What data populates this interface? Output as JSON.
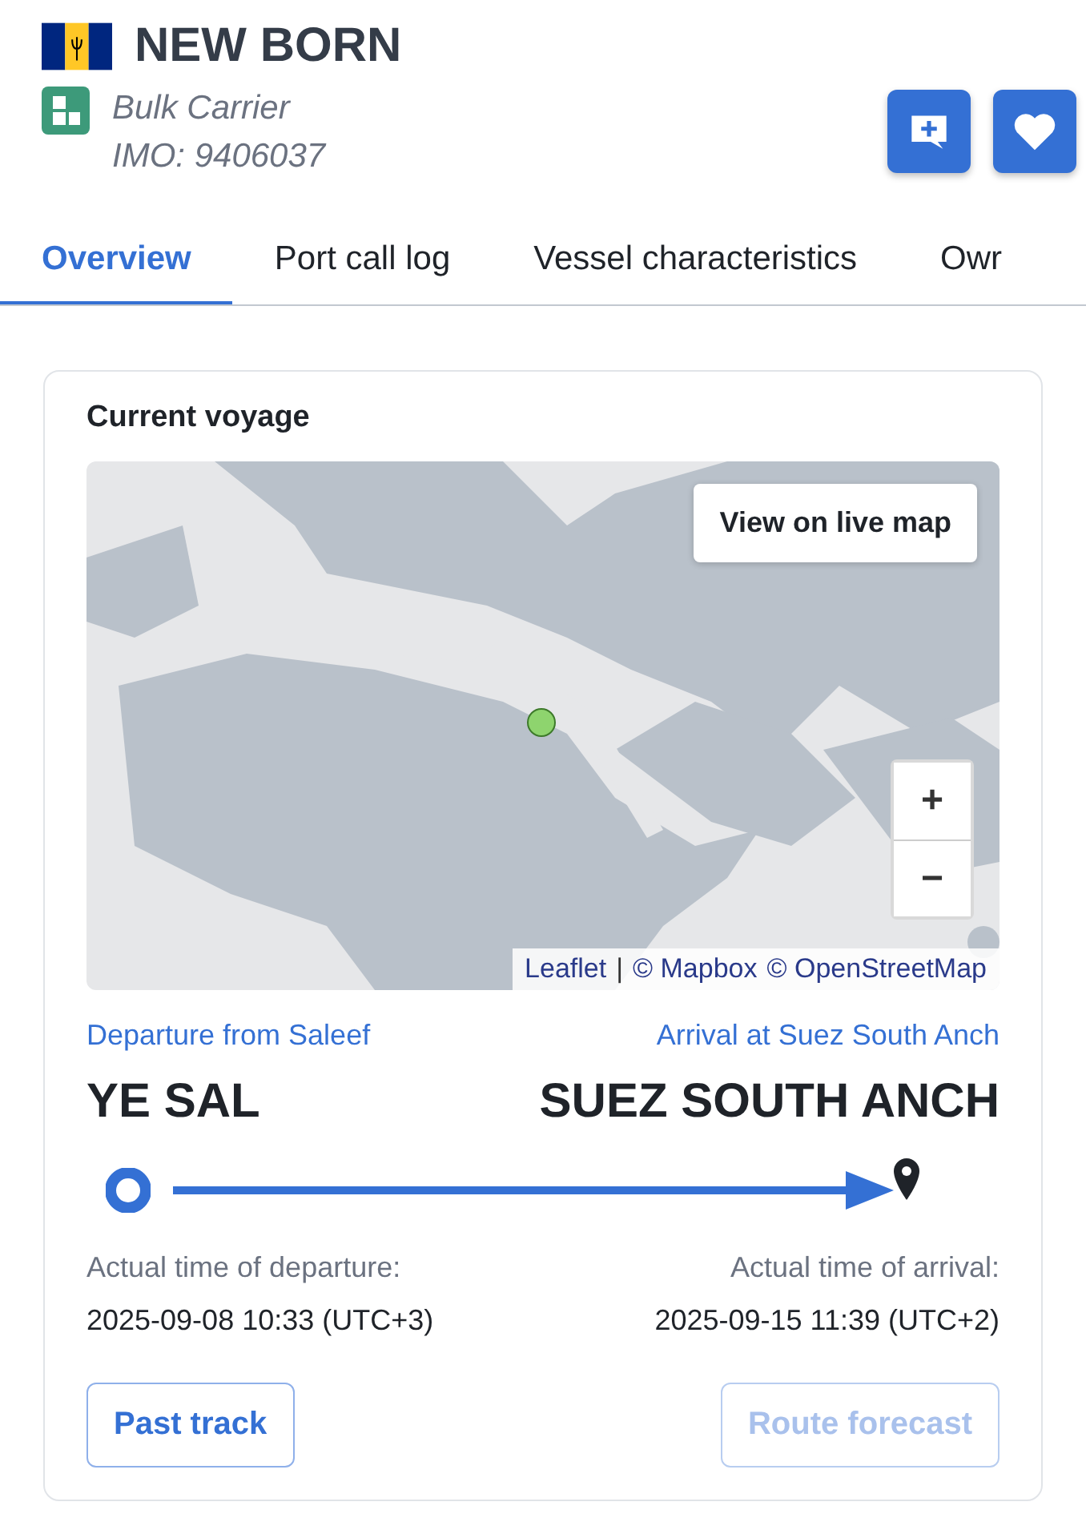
{
  "vessel": {
    "name": "NEW BORN",
    "type": "Bulk Carrier",
    "imo": "IMO: 9406037"
  },
  "actions": [
    {
      "kind": "note"
    },
    {
      "kind": "favorite"
    }
  ],
  "tabs": [
    {
      "label": "Overview",
      "selected": true
    },
    {
      "label": "Port call log",
      "selected": false
    },
    {
      "label": "Vessel characteristics",
      "selected": false
    },
    {
      "label": "Owr",
      "selected": false
    }
  ],
  "voyage": {
    "title": "Current voyage",
    "map": {
      "live_button": "View on live map",
      "zoom_in": "+",
      "zoom_out": "−",
      "attribution": [
        {
          "text": "Leaflet",
          "link": true
        },
        {
          "text": "|",
          "link": false
        },
        {
          "text": "© Mapbox",
          "link": true
        },
        {
          "text": "© OpenStreetMap",
          "link": true
        }
      ]
    },
    "departure": {
      "caption": "Departure from Saleef",
      "port": "YE SAL",
      "time_label": "Actual time of departure:",
      "time": "2025-09-08 10:33 (UTC+3)"
    },
    "arrival": {
      "caption": "Arrival at Suez South Anch",
      "port": "SUEZ SOUTH ANCH",
      "time_label": "Actual time of arrival:",
      "time": "2025-09-15 11:39 (UTC+2)"
    },
    "buttons": [
      {
        "label": "Past track",
        "disabled": false
      },
      {
        "label": "Route forecast",
        "disabled": true
      }
    ]
  }
}
